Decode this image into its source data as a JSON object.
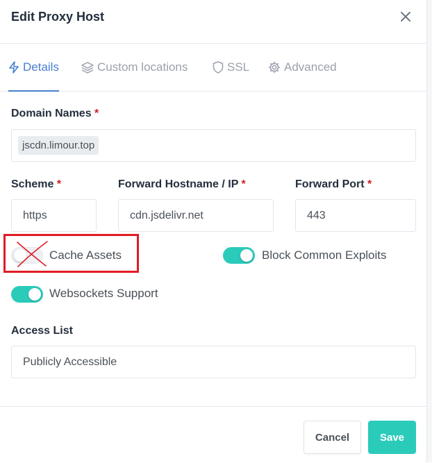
{
  "modal": {
    "title": "Edit Proxy Host",
    "close_icon": "close-icon"
  },
  "tabs": [
    {
      "label": "Details",
      "icon": "lightning-icon",
      "active": true
    },
    {
      "label": "Custom locations",
      "icon": "layers-icon",
      "active": false
    },
    {
      "label": "SSL",
      "icon": "shield-icon",
      "active": false
    },
    {
      "label": "Advanced",
      "icon": "gear-icon",
      "active": false
    }
  ],
  "form": {
    "domain_names": {
      "label": "Domain Names",
      "required_mark": "*",
      "values": [
        "jscdn.limour.top"
      ]
    },
    "scheme": {
      "label": "Scheme",
      "required_mark": "*",
      "value": "https"
    },
    "forward_host": {
      "label": "Forward Hostname / IP",
      "required_mark": "*",
      "value": "cdn.jsdelivr.net"
    },
    "forward_port": {
      "label": "Forward Port",
      "required_mark": "*",
      "value": "443"
    },
    "toggles": {
      "cache_assets": {
        "label": "Cache Assets",
        "checked": false
      },
      "block_exploits": {
        "label": "Block Common Exploits",
        "checked": true
      },
      "websockets": {
        "label": "Websockets Support",
        "checked": true
      }
    },
    "access_list": {
      "label": "Access List",
      "value": "Publicly Accessible"
    }
  },
  "footer": {
    "cancel_label": "Cancel",
    "save_label": "Save"
  },
  "colors": {
    "accent": "#467fcf",
    "toggle_on": "#2bcbba",
    "save_button": "#2bcbba",
    "required": "#cd201f",
    "annotation": "#e01b24"
  }
}
